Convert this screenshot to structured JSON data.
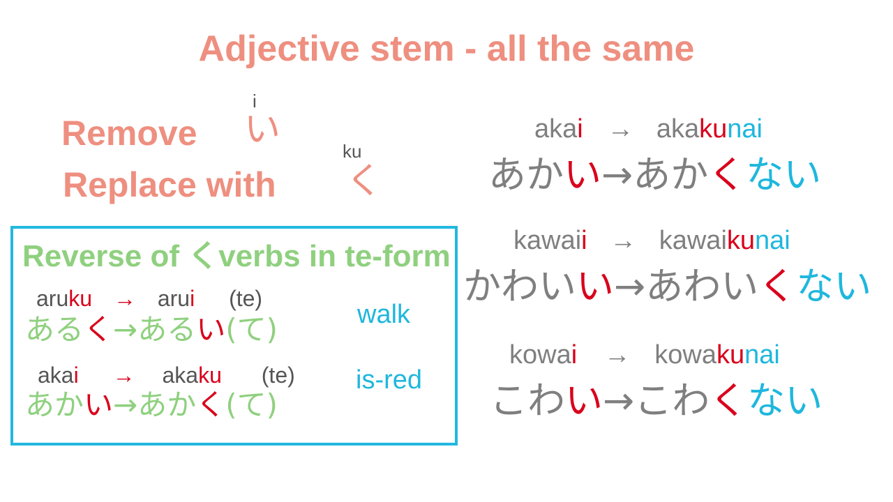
{
  "title": "Adjective stem - all the same",
  "rules": {
    "remove_label": "Remove",
    "remove_char": "い",
    "remove_romaji": "i",
    "replace_label": "Replace with",
    "replace_char": "く",
    "replace_romaji": "ku"
  },
  "box": {
    "title_a": "Reverse of ",
    "title_char": "く",
    "title_b": "verbs in te-form",
    "examples": [
      {
        "r_stem": "aru",
        "r_mark": "ku",
        "r_arrow": "→",
        "r2_stem": "aru",
        "r2_mark": "i",
        "r_te": "(te)",
        "k_stem": "ある",
        "k_mark": "く",
        "k_arrow": "→",
        "k2_stem": "ある",
        "k2_mark": "い",
        "k_te": "(て)",
        "gloss": "walk"
      },
      {
        "r_stem": "aka",
        "r_mark": "i",
        "r_arrow": "→",
        "r2_stem": "aka",
        "r2_mark": "ku",
        "r_te": "(te)",
        "k_stem": "あか",
        "k_mark": "い",
        "k_arrow": "→",
        "k2_stem": "あか",
        "k2_mark": "く",
        "k_te": "(て)",
        "gloss": "is-red"
      }
    ]
  },
  "conversions": [
    {
      "r_stem": "aka",
      "r_mark": "i",
      "r_arrow": "→",
      "r2_stem": "aka",
      "r2_ku": "ku",
      "r2_nai": "nai",
      "k_stem": "あか",
      "k_mark": "い",
      "k_arrow": "→",
      "k2_stem": "あか",
      "k2_ku": "く",
      "k2_nai": "ない"
    },
    {
      "r_stem": "kawai",
      "r_mark": "i",
      "r_arrow": "→",
      "r2_stem": "kawai",
      "r2_ku": "ku",
      "r2_nai": "nai",
      "k_stem": "かわい",
      "k_mark": "い",
      "k_arrow": "→",
      "k2_stem": "あわい",
      "k2_ku": "く",
      "k2_nai": "ない"
    },
    {
      "r_stem": "kowa",
      "r_mark": "i",
      "r_arrow": "→",
      "r2_stem": "kowa",
      "r2_ku": "ku",
      "r2_nai": "nai",
      "k_stem": "こわ",
      "k_mark": "い",
      "k_arrow": "→",
      "k2_stem": "こわ",
      "k2_ku": "く",
      "k2_nai": "ない"
    }
  ]
}
